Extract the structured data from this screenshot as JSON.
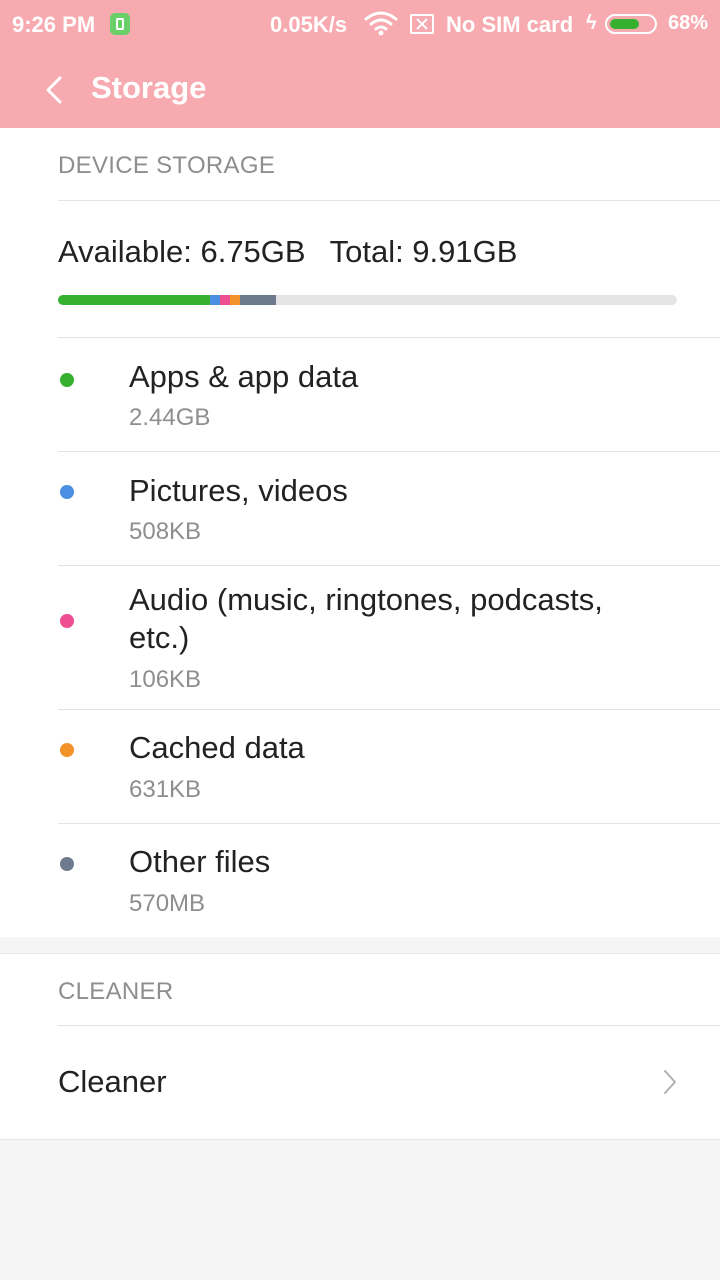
{
  "status_bar": {
    "time": "9:26 PM",
    "network_speed": "0.05K/s",
    "sim_status": "No SIM card",
    "battery_percent": "68%",
    "battery_level": 0.68,
    "icons": [
      "charging-app-icon",
      "wifi-icon",
      "no-sim-icon",
      "charging-bolt-icon",
      "battery-icon"
    ]
  },
  "app_bar": {
    "title": "Storage",
    "back_icon": "back-arrow-icon",
    "color": "#f7abb1"
  },
  "device_storage": {
    "header": "DEVICE STORAGE",
    "available": "Available: 6.75GB",
    "total": "Total: 9.91GB",
    "bar_segments_gb": [
      {
        "category": "Apps & app data",
        "value_gb": 2.44,
        "color": "#36b12f"
      },
      {
        "category": "Pictures, videos",
        "value_gb": 0.16,
        "color": "#4a8fe2"
      },
      {
        "category": "Audio (music, ringtones, podcasts, etc.)",
        "value_gb": 0.16,
        "color": "#ef4f91"
      },
      {
        "category": "Cached data",
        "value_gb": 0.16,
        "color": "#f4922a"
      },
      {
        "category": "Other files",
        "value_gb": 0.57,
        "color": "#6e7b8e"
      }
    ],
    "total_gb": 9.91,
    "items": [
      {
        "label": "Apps & app data",
        "size": "2.44GB",
        "color": "#36b12f"
      },
      {
        "label": "Pictures, videos",
        "size": "508KB",
        "color": "#4a8fe2"
      },
      {
        "label": "Audio (music, ringtones, podcasts, etc.)",
        "size": "106KB",
        "color": "#ef4f91"
      },
      {
        "label": "Cached data",
        "size": "631KB",
        "color": "#f4922a"
      },
      {
        "label": "Other files",
        "size": "570MB",
        "color": "#6e7b8e"
      }
    ]
  },
  "cleaner": {
    "header": "CLEANER",
    "item_label": "Cleaner",
    "chevron_icon": "chevron-right-icon"
  }
}
